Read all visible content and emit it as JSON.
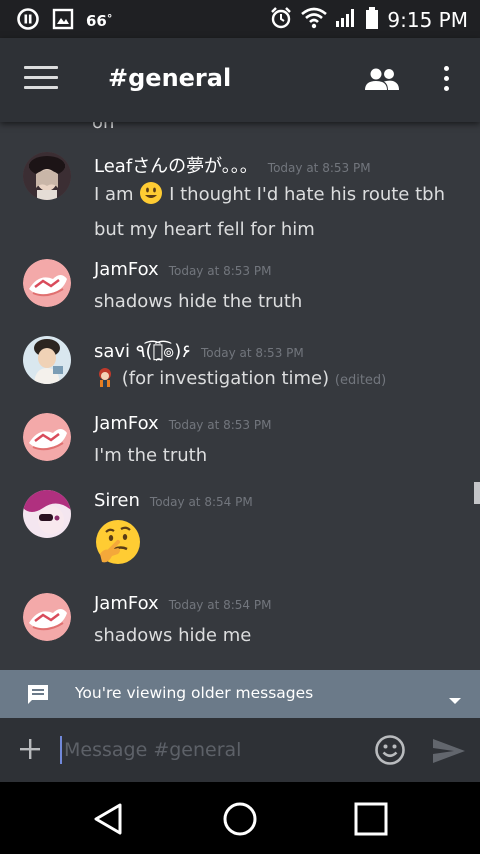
{
  "status_bar": {
    "temperature": "66",
    "degree": "°",
    "time": "9:15 PM",
    "icons": [
      "pause-circle-icon",
      "image-icon",
      "alarm-clock-icon",
      "wifi-icon",
      "signal-icon",
      "battery-icon"
    ]
  },
  "header": {
    "channel": "#general",
    "icons": [
      "hamburger-menu-icon",
      "members-icon",
      "more-vert-icon"
    ]
  },
  "messages": {
    "cutoff_text": "on",
    "items": [
      {
        "author": "Leafさんの夢が。。。",
        "time": "Today at 8:53 PM",
        "text_part1": "I am",
        "emoji": "grinning-emoji",
        "text_part2": "I thought I'd hate his route tbh but my heart fell for him"
      },
      {
        "author": "JamFox",
        "time": "Today at 8:53 PM",
        "text": "shadows hide the truth"
      },
      {
        "author": "savi ٩(͡๏̯͡๏)۶",
        "time": "Today at 8:53 PM",
        "emoji": "custom-character-emoji",
        "text": "(for investigation time)",
        "edited": "(edited)"
      },
      {
        "author": "JamFox",
        "time": "Today at 8:53 PM",
        "text": "I'm the truth"
      },
      {
        "author": "Siren",
        "time": "Today at 8:54 PM",
        "emoji": "thinking-face-emoji"
      },
      {
        "author": "JamFox",
        "time": "Today at 8:54 PM",
        "text": "shadows hide me"
      }
    ]
  },
  "older_banner": {
    "text": "You're viewing older messages",
    "icons": [
      "message-bubble-icon",
      "caret-down-icon"
    ]
  },
  "composer": {
    "placeholder": "Message #general",
    "icons": [
      "plus-icon",
      "emoji-smiley-icon",
      "send-icon"
    ]
  },
  "nav_bar": {
    "icons": [
      "back-triangle-icon",
      "home-circle-icon",
      "recents-square-icon"
    ]
  },
  "colors": {
    "background": "#36393e",
    "header": "#2e3136",
    "status_bar": "#1f2023",
    "banner": "#6b7a89",
    "accent": "#7289da",
    "timestamp": "#72767d"
  }
}
